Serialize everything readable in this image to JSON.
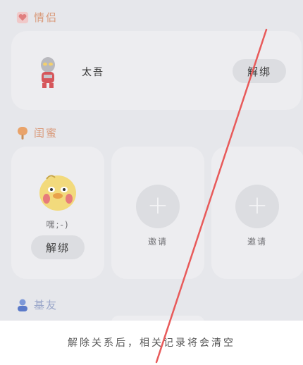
{
  "sections": {
    "couple": {
      "title": "情侣",
      "partner_name": "太吾",
      "unbind_label": "解绑"
    },
    "besties": {
      "title": "闺蜜",
      "friend_nickname": "嘿;-)",
      "unbind_label": "解绑",
      "invite_label_1": "邀请",
      "invite_label_2": "邀请"
    },
    "friends": {
      "title": "基友"
    }
  },
  "footer": {
    "message": "解除关系后，相关记录将会清空"
  },
  "colors": {
    "annotation_line": "#e85a5a",
    "section_title": "#d99a7a"
  }
}
